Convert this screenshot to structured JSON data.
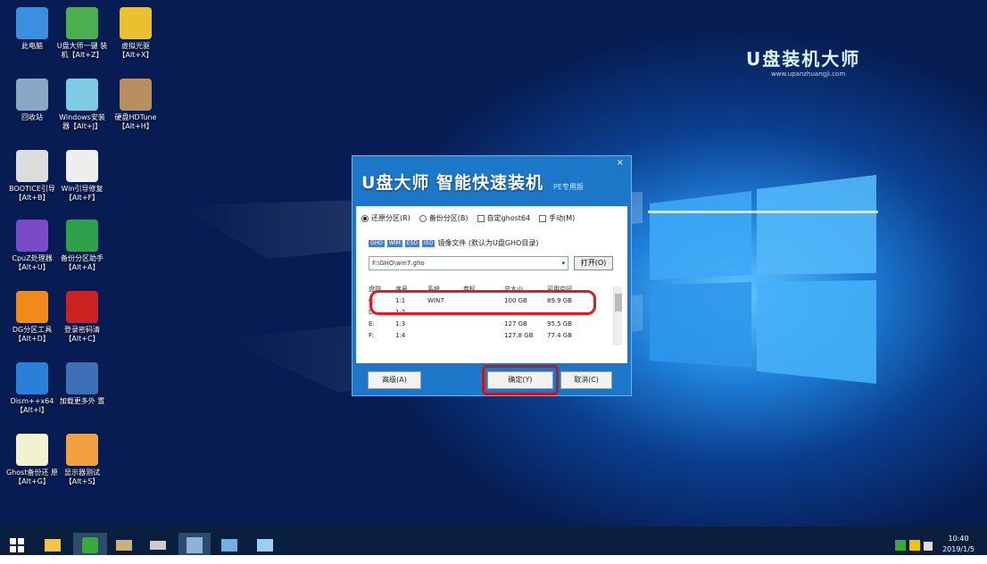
{
  "desktop": {
    "icons": [
      {
        "label": "此电脑",
        "icon": "computer-icon"
      },
      {
        "label": "U盘大师一键 装机【Alt+Z】",
        "icon": "u-master-icon"
      },
      {
        "label": "虚拟光驱 【Alt+X】",
        "icon": "virtual-drive-icon"
      },
      {
        "label": "回收站",
        "icon": "recycle-bin-icon"
      },
      {
        "label": "Windows安装 器【Alt+J】",
        "icon": "windows-installer-icon"
      },
      {
        "label": "硬盘HDTune 【Alt+H】",
        "icon": "hdtune-icon"
      },
      {
        "label": "BOOTICE引导 【Alt+B】",
        "icon": "bootice-icon"
      },
      {
        "label": "Win引导修复 【Alt+F】",
        "icon": "boot-repair-icon"
      },
      {
        "label": "CpuZ处理器 【Alt+U】",
        "icon": "cpuz-icon"
      },
      {
        "label": "备份分区助手 【Alt+A】",
        "icon": "partition-assistant-icon"
      },
      {
        "label": "DG分区工具 【Alt+D】",
        "icon": "diskgenius-icon"
      },
      {
        "label": "登录密码清 【Alt+C】",
        "icon": "password-clear-icon"
      },
      {
        "label": "Dism++x64 【Alt+I】",
        "icon": "dism-icon"
      },
      {
        "label": "加载更多外 置",
        "icon": "load-more-icon"
      },
      {
        "label": "Ghost备份还 原【Alt+G】",
        "icon": "ghost-icon"
      },
      {
        "label": "显示器测试 【Alt+S】",
        "icon": "monitor-test-icon"
      }
    ],
    "brand": {
      "name": "U盘装机大师",
      "url": "www.upanzhuangji.com"
    }
  },
  "dialog": {
    "title": "U盘大师 智能快速装机",
    "subtitle": "PE专用版",
    "close": "×",
    "options": [
      {
        "label": "还原分区(R)",
        "checked": true,
        "kind": "radio"
      },
      {
        "label": "备份分区(B)",
        "checked": false,
        "kind": "radio"
      },
      {
        "label": "自定ghost64",
        "checked": false,
        "kind": "checkbox"
      },
      {
        "label": "手动(M)",
        "checked": false,
        "kind": "checkbox"
      }
    ],
    "tags": [
      "GHO",
      "WIM",
      "ESD",
      "ISO"
    ],
    "image_hint": "镜像文件 (默认为U盘GHO目录)",
    "path_value": "F:\\GHO\\win7.gho",
    "open_label": "打开(O)",
    "table": {
      "headers": [
        "盘符",
        "序号",
        "系统",
        "卷标",
        "总大小",
        "可用空间"
      ],
      "rows": [
        [
          "C:",
          "1:1",
          "WIN7",
          "",
          "100 GB",
          "89.9 GB"
        ],
        [
          "D:",
          "1:2",
          "",
          "",
          "",
          ""
        ],
        [
          "E:",
          "1:3",
          "",
          "",
          "127 GB",
          "95.5 GB"
        ],
        [
          "F:",
          "1:4",
          "",
          "",
          "127.8 GB",
          "77.4 GB"
        ]
      ]
    },
    "buttons": {
      "advanced": "高级(A)",
      "ok": "确定(Y)",
      "cancel": "取消(C)"
    }
  },
  "taskbar": {
    "clock_time": "10:40",
    "clock_date": "2019/1/5"
  }
}
